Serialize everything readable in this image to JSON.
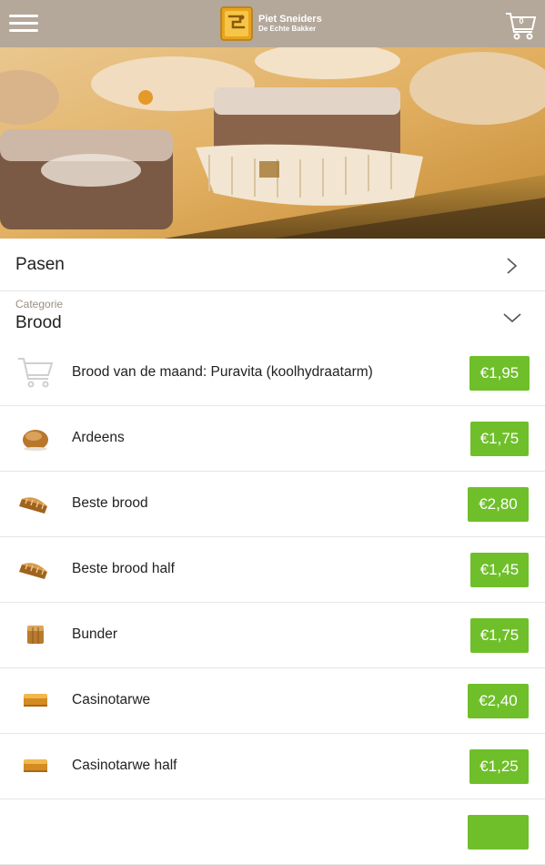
{
  "header": {
    "menu_icon": "hamburger-icon",
    "brand_name": "Piet Sneiders",
    "brand_sub": "De Echte Bakker",
    "cart_icon": "shopping-cart-icon",
    "cart_count": "0",
    "color": "#b3a89a"
  },
  "promo": {
    "label": "Pasen",
    "icon": "chevron-right-icon"
  },
  "category": {
    "caption": "Categorie",
    "value": "Brood",
    "icon": "chevron-down-icon"
  },
  "price_color": "#6fbf2a",
  "products": [
    {
      "name": "Brood van de maand: Puravita (koolhydraatarm)",
      "price": "€1,95",
      "icon": "cart-placeholder-icon"
    },
    {
      "name": "Ardeens",
      "price": "€1,75",
      "icon": "round-bread-icon"
    },
    {
      "name": "Beste brood",
      "price": "€2,80",
      "icon": "loaf-bread-icon"
    },
    {
      "name": "Beste brood half",
      "price": "€1,45",
      "icon": "loaf-bread-icon"
    },
    {
      "name": "Bunder",
      "price": "€1,75",
      "icon": "square-bread-icon"
    },
    {
      "name": "Casinotarwe",
      "price": "€2,40",
      "icon": "tin-bread-icon"
    },
    {
      "name": "Casinotarwe half",
      "price": "€1,25",
      "icon": "tin-bread-icon"
    }
  ]
}
